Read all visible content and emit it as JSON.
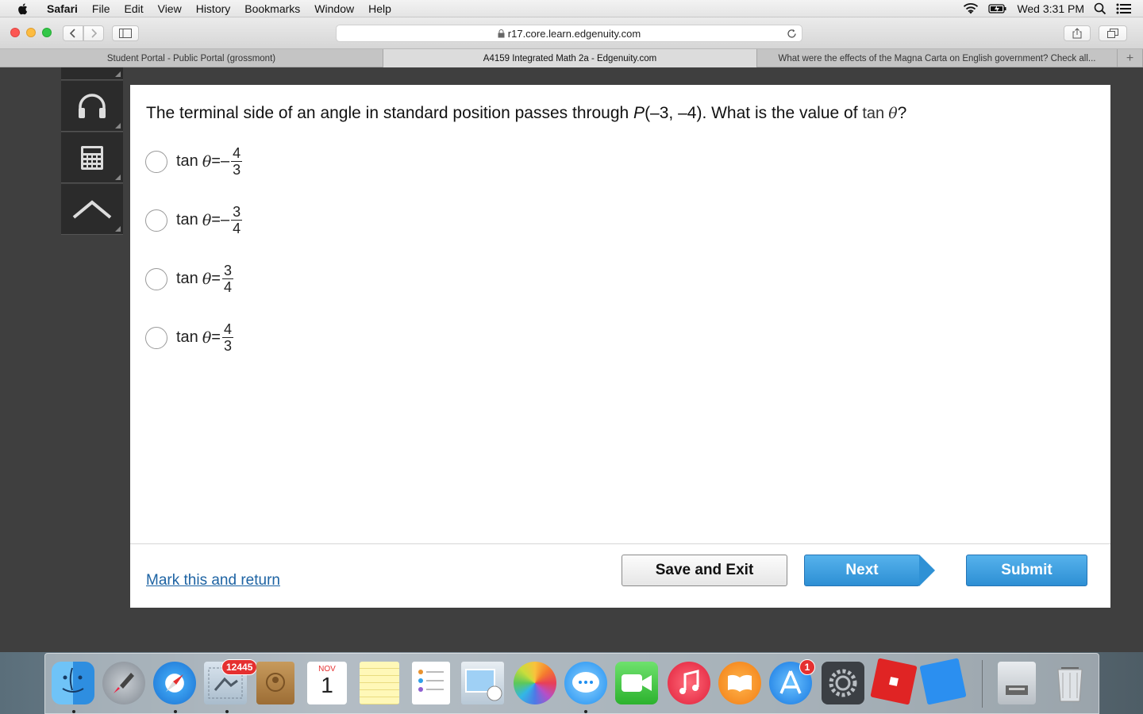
{
  "menubar": {
    "app": "Safari",
    "items": [
      "File",
      "Edit",
      "View",
      "History",
      "Bookmarks",
      "Window",
      "Help"
    ],
    "clock": "Wed 3:31 PM"
  },
  "toolbar": {
    "url": "r17.core.learn.edgenuity.com"
  },
  "tabs": [
    {
      "label": "Student Portal - Public Portal (grossmont)",
      "active": false
    },
    {
      "label": "A4159 Integrated Math 2a - Edgenuity.com",
      "active": true
    },
    {
      "label": "What were the effects of the Magna Carta on English government? Check all...",
      "active": false
    }
  ],
  "question": {
    "prefix": "The terminal side of an angle in standard position passes through ",
    "point_name": "P",
    "point_coords": "(–3, –4)",
    "suffix": ". What is the value of ",
    "fn": "tan",
    "var": "θ",
    "end": "?"
  },
  "options": [
    {
      "fn": "tan",
      "var": "θ",
      "eq": "=",
      "sign": "–",
      "num": "4",
      "den": "3"
    },
    {
      "fn": "tan",
      "var": "θ",
      "eq": "=",
      "sign": "–",
      "num": "3",
      "den": "4"
    },
    {
      "fn": "tan",
      "var": "θ",
      "eq": "=",
      "sign": "",
      "num": "3",
      "den": "4"
    },
    {
      "fn": "tan",
      "var": "θ",
      "eq": "=",
      "sign": "",
      "num": "4",
      "den": "3"
    }
  ],
  "footer": {
    "mark_link": "Mark this and return",
    "save_exit": "Save and Exit",
    "next": "Next",
    "submit": "Submit"
  },
  "dock": {
    "mail_badge": "12445",
    "calendar_month": "NOV",
    "calendar_day": "1",
    "appstore_badge": "1"
  }
}
